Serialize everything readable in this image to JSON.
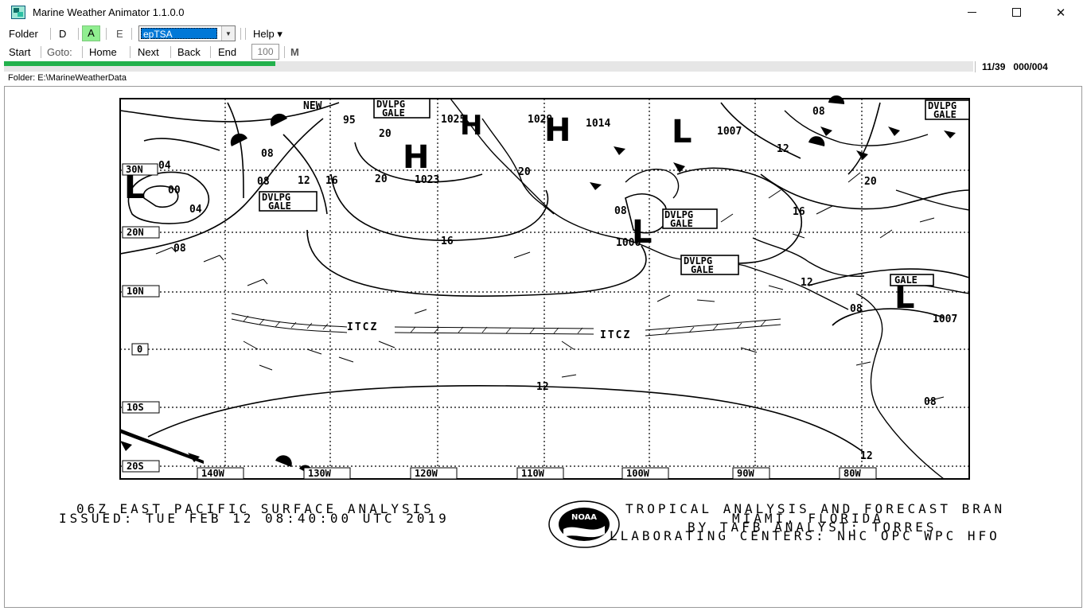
{
  "window": {
    "title": "Marine Weather Animator 1.1.0.0"
  },
  "menu": {
    "folder": "Folder",
    "d": "D",
    "a": "A",
    "e": "E",
    "product": "epTSA",
    "help": "Help ▾"
  },
  "nav": {
    "start": "Start",
    "goto": "Goto:",
    "home": "Home",
    "next": "Next",
    "back": "Back",
    "end": "End",
    "step_value": "100",
    "m": "M"
  },
  "progress": {
    "fraction": 0.28,
    "counter": "11/39",
    "sub_counter": "000/004"
  },
  "folder_path": "Folder: E:\\MarineWeatherData",
  "map": {
    "lat_labels": [
      "30N",
      "20N",
      "10N",
      "0",
      "10S",
      "20S"
    ],
    "lon_labels": [
      "140W",
      "130W",
      "120W",
      "110W",
      "100W",
      "90W",
      "80W"
    ],
    "pressure_centers": [
      "H",
      "H",
      "H",
      "L",
      "L",
      "L",
      "L"
    ],
    "pressure_values": [
      "1025",
      "1023",
      "1029",
      "1014",
      "1007",
      "1006",
      "1007"
    ],
    "isobar_labels": [
      "08",
      "04",
      "00",
      "04",
      "08",
      "12",
      "16",
      "20",
      "20",
      "16",
      "08",
      "08",
      "12",
      "16",
      "12",
      "20",
      "08",
      "12",
      "12",
      "08",
      "95"
    ],
    "boxes": [
      "DVLPG GALE",
      "DVLPG GALE",
      "DVLPG GALE",
      "DVLPG GALE",
      "DVLPG GALE",
      "GALE"
    ],
    "itcz": [
      "ITCZ",
      "ITCZ"
    ],
    "new_label": "NEW"
  },
  "caption": {
    "left_line1": "06Z EAST PACIFIC SURFACE ANALYSIS",
    "left_line2": "ISSUED: TUE FEB 12 08:40:00 UTC 2019",
    "right_line1": "TROPICAL ANALYSIS AND FORECAST BRAN",
    "right_line2": "MIAMI, FLORIDA",
    "right_line3": "BY TAFB ANALYST: TORRES",
    "right_line4": "LLABORATING CENTERS: NHC OPC WPC HFO",
    "logo_text": "NOAA"
  },
  "colors": {
    "progress": "#22b14c",
    "active_button": "#90ee90",
    "selection": "#0078d7"
  }
}
